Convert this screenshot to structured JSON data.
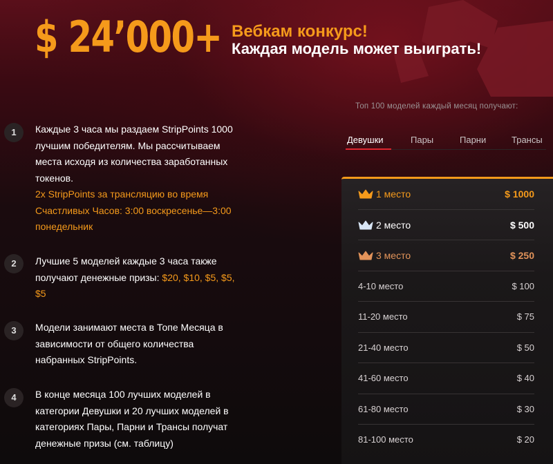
{
  "header": {
    "amount": "$ 24’000+",
    "title": "Вебкам конкурс!",
    "subtitle": "Каждая модель может выиграть!"
  },
  "steps": [
    {
      "number": "1",
      "lines": [
        {
          "text": "Каждые 3 часа мы раздаем StripPoints 1000",
          "highlight": false
        },
        {
          "text": "лучшим победителям. Мы рассчитываем",
          "highlight": false
        },
        {
          "text": "места исходя из количества заработанных",
          "highlight": false
        },
        {
          "text": "токенов.",
          "highlight": false
        },
        {
          "text": "2x StripPoints за трансляцию во время",
          "highlight": true
        },
        {
          "text": "Счастливых Часов: 3:00 воскресенье—3:00",
          "highlight": true
        },
        {
          "text": "понедельник",
          "highlight": true
        }
      ]
    },
    {
      "number": "2",
      "line1": "Лучшие 5 моделей каждые 3 часа также",
      "line2_plain": "получают денежные призы: ",
      "line2_highlight": "$20, $10, $5, $5,",
      "line3_highlight": "$5"
    },
    {
      "number": "3",
      "lines": [
        "Модели занимают места в Топе Месяца в",
        "зависимости от общего количества",
        "набранных StripPoints."
      ]
    },
    {
      "number": "4",
      "lines": [
        "В конце месяца 100 лучших моделей в",
        "категории Девушки и 20 лучших моделей в",
        "категориях Пары, Парни и Трансы получат",
        "денежные призы (см. таблицу)"
      ]
    }
  ],
  "prize_panel": {
    "caption": "Топ 100 моделей каждый месяц получают:",
    "tabs": [
      {
        "label": "Девушки",
        "active": true
      },
      {
        "label": "Пары",
        "active": false
      },
      {
        "label": "Парни",
        "active": false
      },
      {
        "label": "Трансы",
        "active": false
      }
    ],
    "rows": [
      {
        "place": "1 место",
        "prize": "$ 1000",
        "crown": "gold"
      },
      {
        "place": "2 место",
        "prize": "$ 500",
        "crown": "silver"
      },
      {
        "place": "3 место",
        "prize": "$ 250",
        "crown": "bronze"
      },
      {
        "place": "4-10 место",
        "prize": "$ 100",
        "crown": null
      },
      {
        "place": "11-20 место",
        "prize": "$ 75",
        "crown": null
      },
      {
        "place": "21-40 место",
        "prize": "$ 50",
        "crown": null
      },
      {
        "place": "41-60 место",
        "prize": "$ 40",
        "crown": null
      },
      {
        "place": "61-80 место",
        "prize": "$ 30",
        "crown": null
      },
      {
        "place": "81-100 место",
        "prize": "$ 20",
        "crown": null
      }
    ],
    "colors": {
      "accent": "#f59a1b",
      "tab_active_underline": "#e0262f",
      "crown_gold": "#f59a1b",
      "crown_silver": "#d8e6f5",
      "crown_bronze": "#e2935a"
    }
  }
}
